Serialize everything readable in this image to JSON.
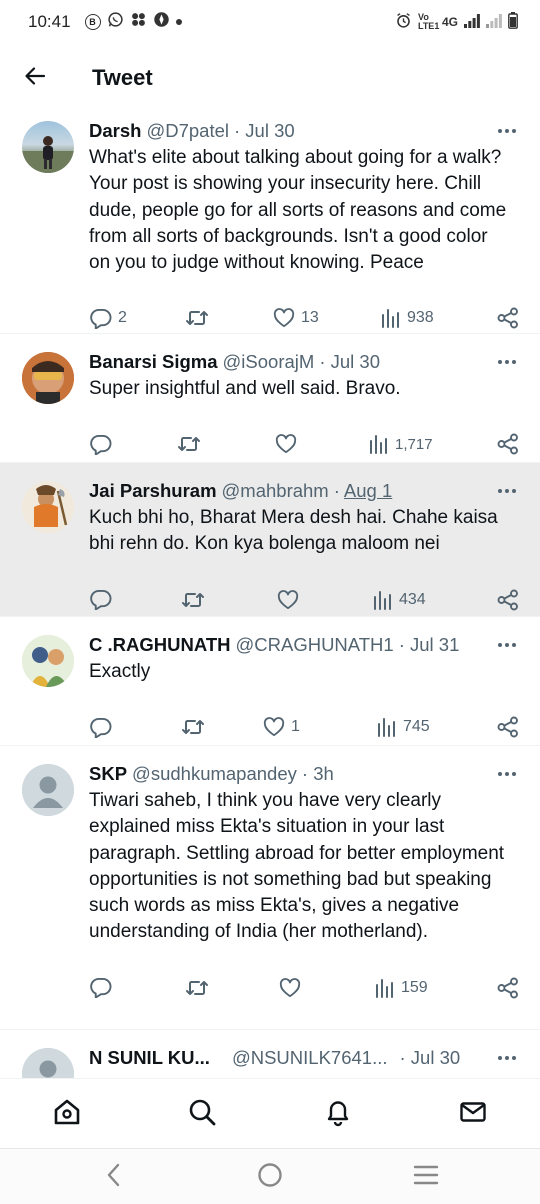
{
  "status_bar": {
    "time": "10:41",
    "network": "4G",
    "volte": "Vo LTE1"
  },
  "header": {
    "title": "Tweet"
  },
  "tweets": [
    {
      "name": "Darsh",
      "handle": "@D7patel",
      "date": "· Jul 30",
      "text": "What's elite about talking about going for a walk? Your post is showing your insecurity here. Chill dude, people go for all sorts of reasons and come from all sorts of backgrounds. Isn't a good color on you to judge without knowing. Peace",
      "replies": "2",
      "retweets": "",
      "likes": "13",
      "views": "938"
    },
    {
      "name": "Banarsi Sigma",
      "handle": "@iSoorajM",
      "date": "· Jul 30",
      "text": "Super insightful and well said. Bravo.",
      "replies": "",
      "retweets": "",
      "likes": "",
      "views": "1,717"
    },
    {
      "name": "Jai Parshuram",
      "handle": "@mahbrahm",
      "date_sep": "·",
      "date": "Aug 1",
      "text": "Kuch bhi ho, Bharat Mera desh hai. Chahe kaisa bhi rehn do. Kon kya bolenga maloom nei",
      "replies": "",
      "retweets": "",
      "likes": "",
      "views": "434"
    },
    {
      "name": "C .RAGHUNATH",
      "handle": "@CRAGHUNATH1",
      "date": "· Jul 31",
      "text": "Exactly",
      "replies": "",
      "retweets": "",
      "likes": "1",
      "views": "745"
    },
    {
      "name": "SKP",
      "handle": "@sudhkumapandey",
      "date": "· 3h",
      "text": "Tiwari saheb, I think you have very clearly explained miss Ekta's situation in your last paragraph. Settling abroad for better employment opportunities is not something bad but speaking such words as miss Ekta's, gives a negative understanding of India (her motherland).",
      "replies": "",
      "retweets": "",
      "likes": "",
      "views": "159"
    },
    {
      "name": "N SUNIL KU...",
      "handle": "@NSUNILK7641...",
      "date": "· Jul 30",
      "text": "",
      "replies": "",
      "retweets": "",
      "likes": "",
      "views": ""
    }
  ],
  "icons": {
    "back": "arrow-left-icon",
    "more": "more-dots-icon",
    "reply": "reply-icon",
    "retweet": "retweet-icon",
    "like": "heart-icon",
    "views": "views-chart-icon",
    "share": "share-icon",
    "home": "home-icon",
    "search": "search-icon",
    "notifications": "bell-icon",
    "messages": "mail-icon"
  },
  "colors": {
    "text": "#0f1419",
    "secondary": "#536471",
    "highlight_bg": "#ebebeb",
    "divider": "#eff3f4"
  }
}
